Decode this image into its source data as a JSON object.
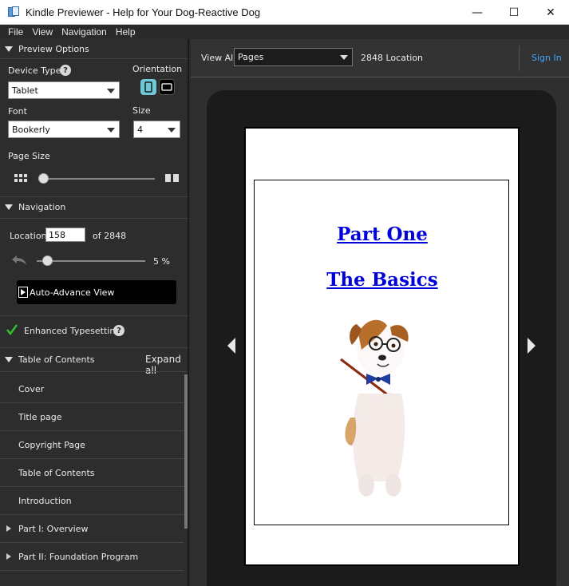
{
  "window": {
    "title": "Kindle Previewer - Help for Your Dog-Reactive Dog",
    "minimize": "—",
    "maximize": "☐",
    "close": "✕"
  },
  "menu": [
    "File",
    "View",
    "Navigation",
    "Help"
  ],
  "preview_options": {
    "header": "Preview Options",
    "device_type_label": "Device Type",
    "device_type_value": "Tablet",
    "orientation_label": "Orientation",
    "font_label": "Font",
    "font_value": "Bookerly",
    "size_label": "Size",
    "size_value": "4",
    "page_size_label": "Page Size",
    "page_size_level": 0.0
  },
  "navigation": {
    "header": "Navigation",
    "location_label": "Location",
    "location_value": "158",
    "of_total": "of 2848",
    "progress_percent_text": "5 %",
    "progress": 0.05,
    "auto_advance_label": "Auto-Advance View"
  },
  "enhanced_typesetting": {
    "label": "Enhanced Typesetting",
    "checked": true
  },
  "toc": {
    "header": "Table of Contents",
    "expand_all": "Expand all",
    "items": [
      {
        "label": "Cover",
        "expandable": false
      },
      {
        "label": "Title page",
        "expandable": false
      },
      {
        "label": "Copyright Page",
        "expandable": false
      },
      {
        "label": "Table of Contents",
        "expandable": false
      },
      {
        "label": "Introduction",
        "expandable": false
      },
      {
        "label": "Part I: Overview",
        "expandable": true
      },
      {
        "label": "Part II: Foundation Program",
        "expandable": true
      }
    ]
  },
  "viewer": {
    "view_all_label": "View All",
    "view_mode": "Pages",
    "location_count": "2848 Location",
    "sign_in": "Sign In",
    "heading_1": "Part One",
    "heading_2": "The Basics"
  },
  "colors": {
    "link_blue": "#0000d8",
    "sign_in_blue": "#3ea6ff",
    "check_green": "#2ec22e",
    "orientation_active": "#6fc8d8"
  }
}
